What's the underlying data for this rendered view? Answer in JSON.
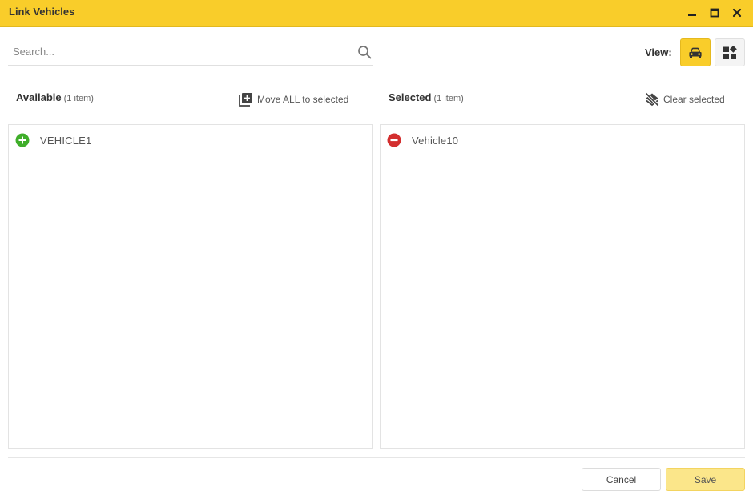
{
  "window": {
    "title": "Link Vehicles",
    "controls": [
      "minimize-icon",
      "maximize-icon",
      "close-icon"
    ]
  },
  "search": {
    "placeholder": "Search...",
    "value": ""
  },
  "view": {
    "label": "View:",
    "active": "vehicle-icon",
    "options": [
      "vehicle-icon",
      "group-icon"
    ]
  },
  "available": {
    "heading": "Available",
    "count": "(1 item)",
    "action_label": "Move ALL to selected",
    "items": [
      {
        "label": "VEHICLE1",
        "icon": "add-circle-icon"
      }
    ]
  },
  "selected": {
    "heading": "Selected",
    "count": "(1 item)",
    "action_label": "Clear selected",
    "items": [
      {
        "label": "Vehicle10",
        "icon": "remove-circle-icon"
      }
    ]
  },
  "footer": {
    "cancel_label": "Cancel",
    "save_label": "Save"
  },
  "colors": {
    "accent": "#f9cd2a",
    "add": "#3fae2a",
    "remove": "#d32f2f",
    "save_bg": "#fbe68a"
  }
}
